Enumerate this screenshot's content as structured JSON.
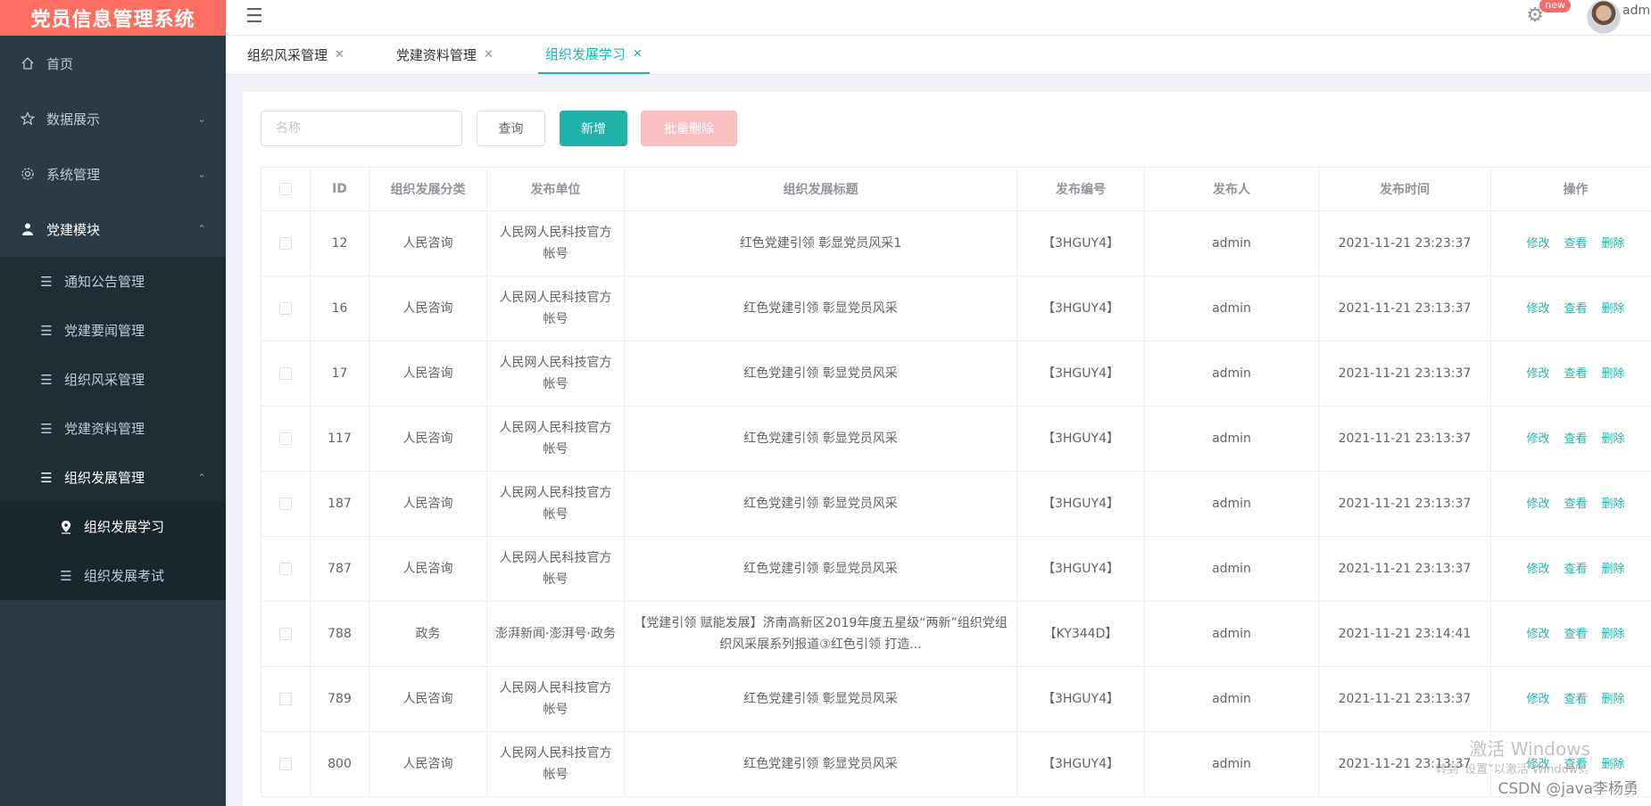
{
  "app": {
    "title": "党员信息管理系统",
    "user": "admin",
    "badge": "new"
  },
  "sidebar": {
    "home": "首页",
    "data_display": "数据展示",
    "system": "系统管理",
    "party_module": "党建模块",
    "sub": [
      "通知公告管理",
      "党建要闻管理",
      "组织风采管理",
      "党建资料管理",
      "组织发展管理"
    ],
    "subsub": [
      "组织发展学习",
      "组织发展考试"
    ]
  },
  "tabs": [
    {
      "label": "组织风采管理"
    },
    {
      "label": "党建资料管理"
    },
    {
      "label": "组织发展学习"
    }
  ],
  "toolbar": {
    "search_placeholder": "名称",
    "query": "查询",
    "add": "新增",
    "batch_delete": "批量删除"
  },
  "table": {
    "headers": [
      "ID",
      "组织发展分类",
      "发布单位",
      "组织发展标题",
      "发布编号",
      "发布人",
      "发布时间",
      "操作"
    ],
    "ops": [
      "修改",
      "查看",
      "删除"
    ],
    "rows": [
      {
        "id": "12",
        "cat": "人民咨询",
        "unit": "人民网人民科技官方帐号",
        "title": "红色党建引领 彰显党员风采1",
        "code": "【3HGUY4】",
        "author": "admin",
        "time": "2021-11-21 23:23:37"
      },
      {
        "id": "16",
        "cat": "人民咨询",
        "unit": "人民网人民科技官方帐号",
        "title": "红色党建引领 彰显党员风采",
        "code": "【3HGUY4】",
        "author": "admin",
        "time": "2021-11-21 23:13:37"
      },
      {
        "id": "17",
        "cat": "人民咨询",
        "unit": "人民网人民科技官方帐号",
        "title": "红色党建引领 彰显党员风采",
        "code": "【3HGUY4】",
        "author": "admin",
        "time": "2021-11-21 23:13:37"
      },
      {
        "id": "117",
        "cat": "人民咨询",
        "unit": "人民网人民科技官方帐号",
        "title": "红色党建引领 彰显党员风采",
        "code": "【3HGUY4】",
        "author": "admin",
        "time": "2021-11-21 23:13:37"
      },
      {
        "id": "187",
        "cat": "人民咨询",
        "unit": "人民网人民科技官方帐号",
        "title": "红色党建引领 彰显党员风采",
        "code": "【3HGUY4】",
        "author": "admin",
        "time": "2021-11-21 23:13:37"
      },
      {
        "id": "787",
        "cat": "人民咨询",
        "unit": "人民网人民科技官方帐号",
        "title": "红色党建引领 彰显党员风采",
        "code": "【3HGUY4】",
        "author": "admin",
        "time": "2021-11-21 23:13:37"
      },
      {
        "id": "788",
        "cat": "政务",
        "unit": "澎湃新闻·澎湃号·政务",
        "title": "【党建引领 赋能发展】济南高新区2019年度五星级“两新”组织党组织风采展系列报道③红色引领 打造...",
        "code": "【KY344D】",
        "author": "admin",
        "time": "2021-11-21 23:14:41"
      },
      {
        "id": "789",
        "cat": "人民咨询",
        "unit": "人民网人民科技官方帐号",
        "title": "红色党建引领 彰显党员风采",
        "code": "【3HGUY4】",
        "author": "admin",
        "time": "2021-11-21 23:13:37"
      },
      {
        "id": "800",
        "cat": "人民咨询",
        "unit": "人民网人民科技官方帐号",
        "title": "红色党建引领 彰显党员风采",
        "code": "【3HGUY4】",
        "author": "admin",
        "time": "2021-11-21 23:13:37"
      }
    ]
  },
  "overlay": {
    "watermark": "激活 Windows",
    "watermark_sub": "转到“设置”以激活 Windows。",
    "csdn": "CSDN @java李杨勇"
  }
}
